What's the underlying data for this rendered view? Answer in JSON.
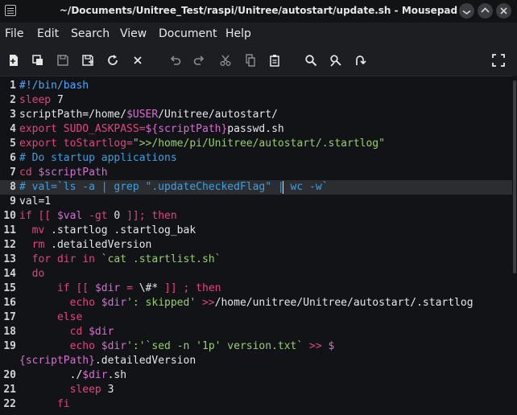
{
  "window": {
    "title": "~/Documents/Unitree_Test/raspi/Unitree/autostart/update.sh - Mousepad"
  },
  "menu": [
    "File",
    "Edit",
    "Search",
    "View",
    "Document",
    "Help"
  ],
  "toolbar": {
    "icons": [
      "new-document-icon",
      "new-window-icon",
      "save-icon",
      "save-as-icon",
      "reload-icon",
      "close-icon",
      "undo-icon",
      "redo-icon",
      "cut-icon",
      "copy-icon",
      "paste-icon",
      "find-icon",
      "find-replace-icon",
      "goto-line-icon",
      "fullscreen-icon"
    ]
  },
  "colors": {
    "text": "#e6e6e6",
    "keyword": "#e0457b",
    "comment": "#3aa0e6",
    "string": "#98ce6b",
    "variable": "#d46fd0",
    "shebang": "#4aa8ff"
  },
  "editor": {
    "cursor_line": 8,
    "lines": [
      {
        "n": "1",
        "tokens": [
          {
            "t": "#!/bin/bash",
            "c": "shebang"
          }
        ]
      },
      {
        "n": "2",
        "tokens": [
          {
            "t": "sleep",
            "c": "keyword"
          },
          {
            "t": " 7",
            "c": "text"
          }
        ]
      },
      {
        "n": "3",
        "tokens": [
          {
            "t": "scriptPath=/home/",
            "c": "text"
          },
          {
            "t": "$USER",
            "c": "variable"
          },
          {
            "t": "/Unitree/autostart/",
            "c": "text"
          }
        ]
      },
      {
        "n": "4",
        "tokens": [
          {
            "t": "export",
            "c": "keyword"
          },
          {
            "t": " SUDO_ASKPASS=",
            "c": "keyword"
          },
          {
            "t": "${scriptPath}",
            "c": "variable"
          },
          {
            "t": "passwd.sh",
            "c": "text"
          }
        ]
      },
      {
        "n": "5",
        "tokens": [
          {
            "t": "export",
            "c": "keyword"
          },
          {
            "t": " toStartlog=",
            "c": "keyword"
          },
          {
            "t": "\">>/home/pi/Unitree/autostart/.startlog\"",
            "c": "string"
          }
        ]
      },
      {
        "n": "6",
        "tokens": [
          {
            "t": "# Do startup applications",
            "c": "comment"
          }
        ]
      },
      {
        "n": "7",
        "tokens": [
          {
            "t": "cd",
            "c": "keyword"
          },
          {
            "t": " $scriptPath",
            "c": "variable"
          }
        ]
      },
      {
        "n": "8",
        "tokens": [
          {
            "t": "# val=`ls -a | grep \".updateCheckedFlag\" | wc -w`",
            "c": "comment"
          }
        ]
      },
      {
        "n": "9",
        "tokens": [
          {
            "t": "val=1",
            "c": "text"
          }
        ]
      },
      {
        "n": "10",
        "tokens": [
          {
            "t": "if",
            "c": "keyword"
          },
          {
            "t": " [[ ",
            "c": "keyword"
          },
          {
            "t": "$val",
            "c": "variable"
          },
          {
            "t": " -gt ",
            "c": "keyword"
          },
          {
            "t": "0 ",
            "c": "text"
          },
          {
            "t": "]]; then",
            "c": "keyword"
          }
        ]
      },
      {
        "n": "11",
        "tokens": [
          {
            "t": "  mv",
            "c": "keyword"
          },
          {
            "t": " .startlog .startlog_bak",
            "c": "text"
          }
        ]
      },
      {
        "n": "12",
        "tokens": [
          {
            "t": "  rm",
            "c": "keyword"
          },
          {
            "t": " .detailedVersion",
            "c": "text"
          }
        ]
      },
      {
        "n": "13",
        "tokens": [
          {
            "t": "  for dir in ",
            "c": "keyword"
          },
          {
            "t": "`cat .startlist.sh`",
            "c": "string"
          }
        ]
      },
      {
        "n": "14",
        "tokens": [
          {
            "t": "  do",
            "c": "keyword"
          }
        ]
      },
      {
        "n": "15",
        "tokens": [
          {
            "t": "      if",
            "c": "keyword"
          },
          {
            "t": " [[ ",
            "c": "keyword"
          },
          {
            "t": "$dir",
            "c": "variable"
          },
          {
            "t": " = ",
            "c": "keyword"
          },
          {
            "t": "\\#*",
            "c": "text"
          },
          {
            "t": " ]] ; then",
            "c": "keyword"
          }
        ]
      },
      {
        "n": "16",
        "tokens": [
          {
            "t": "        echo",
            "c": "keyword"
          },
          {
            "t": " $dir",
            "c": "variable"
          },
          {
            "t": "': skipped'",
            "c": "string"
          },
          {
            "t": " >>",
            "c": "keyword"
          },
          {
            "t": "/home/unitree/Unitree/autostart/.startlog",
            "c": "text"
          }
        ]
      },
      {
        "n": "17",
        "tokens": [
          {
            "t": "      else",
            "c": "keyword"
          }
        ]
      },
      {
        "n": "18",
        "tokens": [
          {
            "t": "        cd",
            "c": "keyword"
          },
          {
            "t": " $dir",
            "c": "variable"
          }
        ]
      },
      {
        "n": "19",
        "tokens": [
          {
            "t": "        echo",
            "c": "keyword"
          },
          {
            "t": " $dir",
            "c": "variable"
          },
          {
            "t": "':'",
            "c": "string"
          },
          {
            "t": "`sed -n '1p' version.txt`",
            "c": "string"
          },
          {
            "t": " >> ",
            "c": "keyword"
          },
          {
            "t": "$",
            "c": "variable"
          }
        ]
      },
      {
        "n": "",
        "tokens": [
          {
            "t": "{scriptPath}",
            "c": "variable"
          },
          {
            "t": ".detailedVersion",
            "c": "text"
          }
        ]
      },
      {
        "n": "20",
        "tokens": [
          {
            "t": "        ./",
            "c": "text"
          },
          {
            "t": "$dir",
            "c": "variable"
          },
          {
            "t": ".sh",
            "c": "text"
          }
        ]
      },
      {
        "n": "21",
        "tokens": [
          {
            "t": "        sleep",
            "c": "keyword"
          },
          {
            "t": " 3",
            "c": "text"
          }
        ]
      },
      {
        "n": "22",
        "tokens": [
          {
            "t": "      fi",
            "c": "keyword"
          }
        ]
      }
    ]
  }
}
